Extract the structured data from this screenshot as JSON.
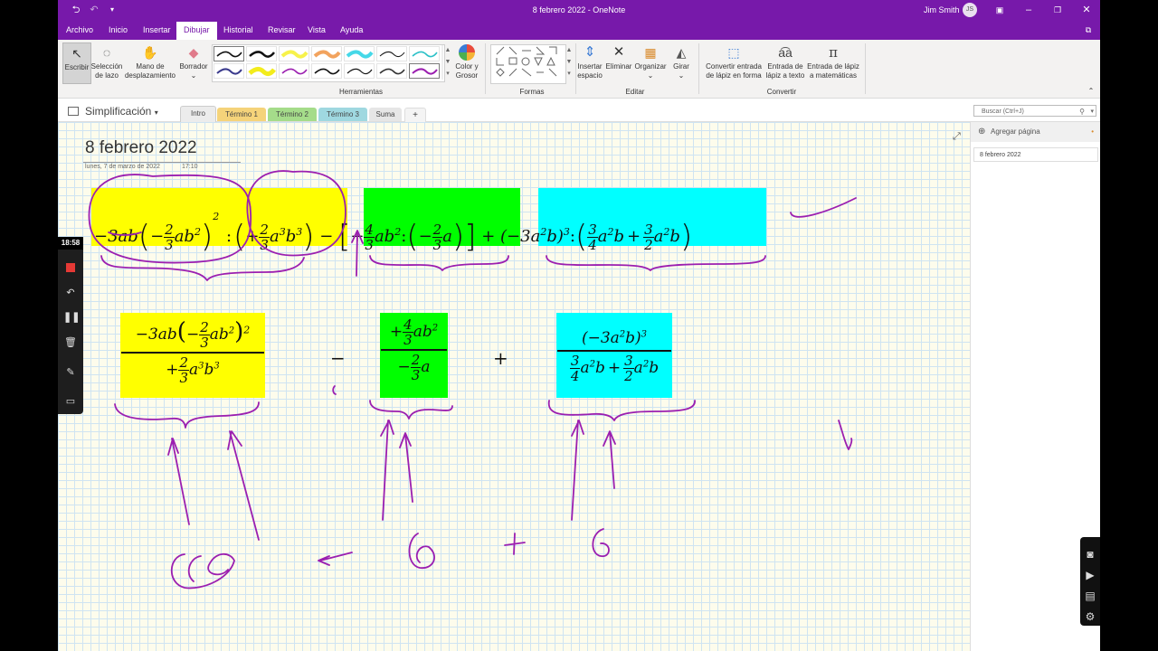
{
  "titlebar": {
    "title": "8 febrero 2022  -  OneNote",
    "user": "Jim Smith",
    "initials": "JS"
  },
  "menu": [
    "Archivo",
    "Inicio",
    "Insertar",
    "Dibujar",
    "Historial",
    "Revisar",
    "Vista",
    "Ayuda"
  ],
  "ribbon": {
    "write": "Escribir",
    "lasso": [
      "Selección",
      "de lazo"
    ],
    "pan": [
      "Mano de",
      "desplazamiento"
    ],
    "eraser": "Borrador",
    "color": [
      "Color y",
      "Grosor"
    ],
    "insert_space": [
      "Insertar",
      "espacio"
    ],
    "delete": "Eliminar",
    "arrange": "Organizar",
    "rotate": "Girar",
    "ink_to_shape": [
      "Convertir entrada",
      "de lápiz en forma"
    ],
    "ink_to_text": [
      "Entrada de",
      "lápiz a texto"
    ],
    "ink_to_math": [
      "Entrada de lápiz",
      "a matemáticas"
    ],
    "groups": [
      "Herramientas",
      "Formas",
      "Editar",
      "Convertir"
    ]
  },
  "notebook": {
    "name": "Simplificación",
    "tabs": [
      {
        "label": "Intro",
        "color": "#e8e8e8"
      },
      {
        "label": "Término 1",
        "color": "#f5d37a"
      },
      {
        "label": "Término 2",
        "color": "#a5dc8a"
      },
      {
        "label": "Término 3",
        "color": "#9fd8e0"
      },
      {
        "label": "Suma",
        "color": "#e6e6e6"
      }
    ],
    "add_tab": "+",
    "search_placeholder": "Buscar (Ctrl+J)"
  },
  "page": {
    "title": "8 febrero 2022",
    "date": "lunes, 7 de marzo de 2022",
    "time": "17:10"
  },
  "math": {
    "top": {
      "t1_prefix": "−3ab",
      "frac_2_3": {
        "n": "2",
        "d": "3"
      },
      "t1_var": "ab",
      "exp2": "2",
      "colon": ":",
      "plus": "+",
      "t2_var": "a",
      "exp3": "3",
      "t2_b": "b",
      "minus": "−",
      "frac_4_3": {
        "n": "4",
        "d": "3"
      },
      "t3_var": "ab",
      "t3_a": "a",
      "t4_base": "(−3a",
      "t4_b": "b)",
      "frac_3_4": {
        "n": "3",
        "d": "4"
      },
      "frac_3_2": {
        "n": "3",
        "d": "2"
      },
      "t4_ab": "a",
      "t4_b2": "b"
    },
    "bottom": {
      "yellow_num": "−3ab",
      "yellow_num_var": "ab",
      "yellow_den": "+",
      "yellow_den_var": "a",
      "minus": "−",
      "green_num_prefix": "+",
      "green_num_var": "ab",
      "green_den_prefix": "−",
      "green_den_var": "a",
      "plus": "+",
      "cyan_num": "(−3a",
      "cyan_num_b": "b)",
      "cyan_den_a": "a",
      "cyan_den_b": "b"
    }
  },
  "panel": {
    "add_page": "Agregar página",
    "pages": [
      "8 febrero 2022"
    ]
  },
  "recorder": {
    "time": "18:58"
  },
  "colors": {
    "accent": "#7719AA",
    "yellow": "#ffff00",
    "green": "#00ff00",
    "cyan": "#00ffff",
    "ink": "#9b1fb0"
  }
}
